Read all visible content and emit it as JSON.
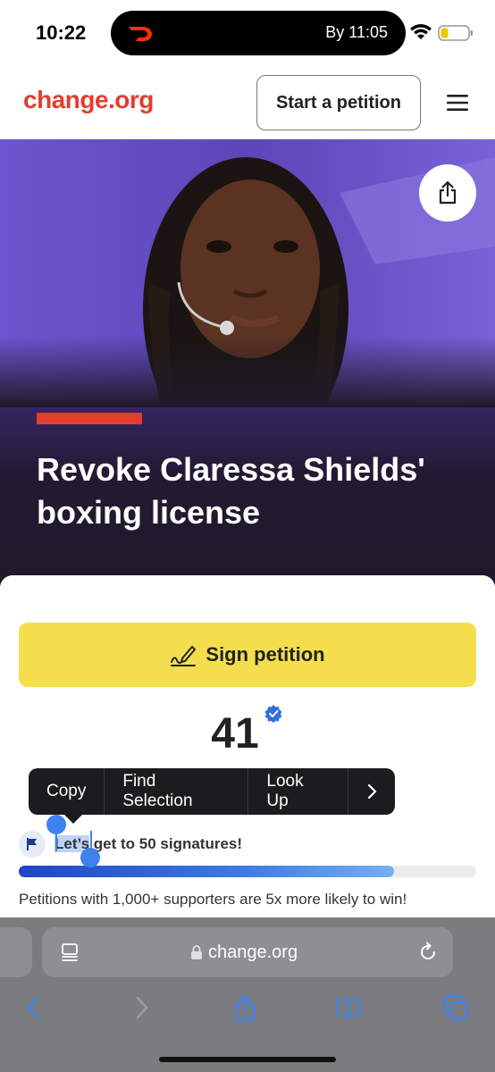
{
  "status_bar": {
    "time": "10:22",
    "activity_text": "By 11:05"
  },
  "header": {
    "brand": "change.org",
    "start_button": "Start a petition"
  },
  "hero": {
    "title": "Revoke Claressa Shields' boxing license"
  },
  "petition": {
    "sign_button": "Sign petition",
    "signature_count": "41",
    "goal_selected": "Let’s",
    "goal_rest": " get to 50 signatures!",
    "progress_fraction": 0.82,
    "hint": "Petitions with 1,000+ supporters are 5x more likely to win!"
  },
  "context_menu": {
    "items": [
      "Copy",
      "Find Selection",
      "Look Up"
    ]
  },
  "browser": {
    "url": "change.org"
  },
  "colors": {
    "brand": "#e33d2f",
    "sign_button": "#f5de4d",
    "progress": "#1e46c2",
    "selection": "#3e82f0"
  }
}
